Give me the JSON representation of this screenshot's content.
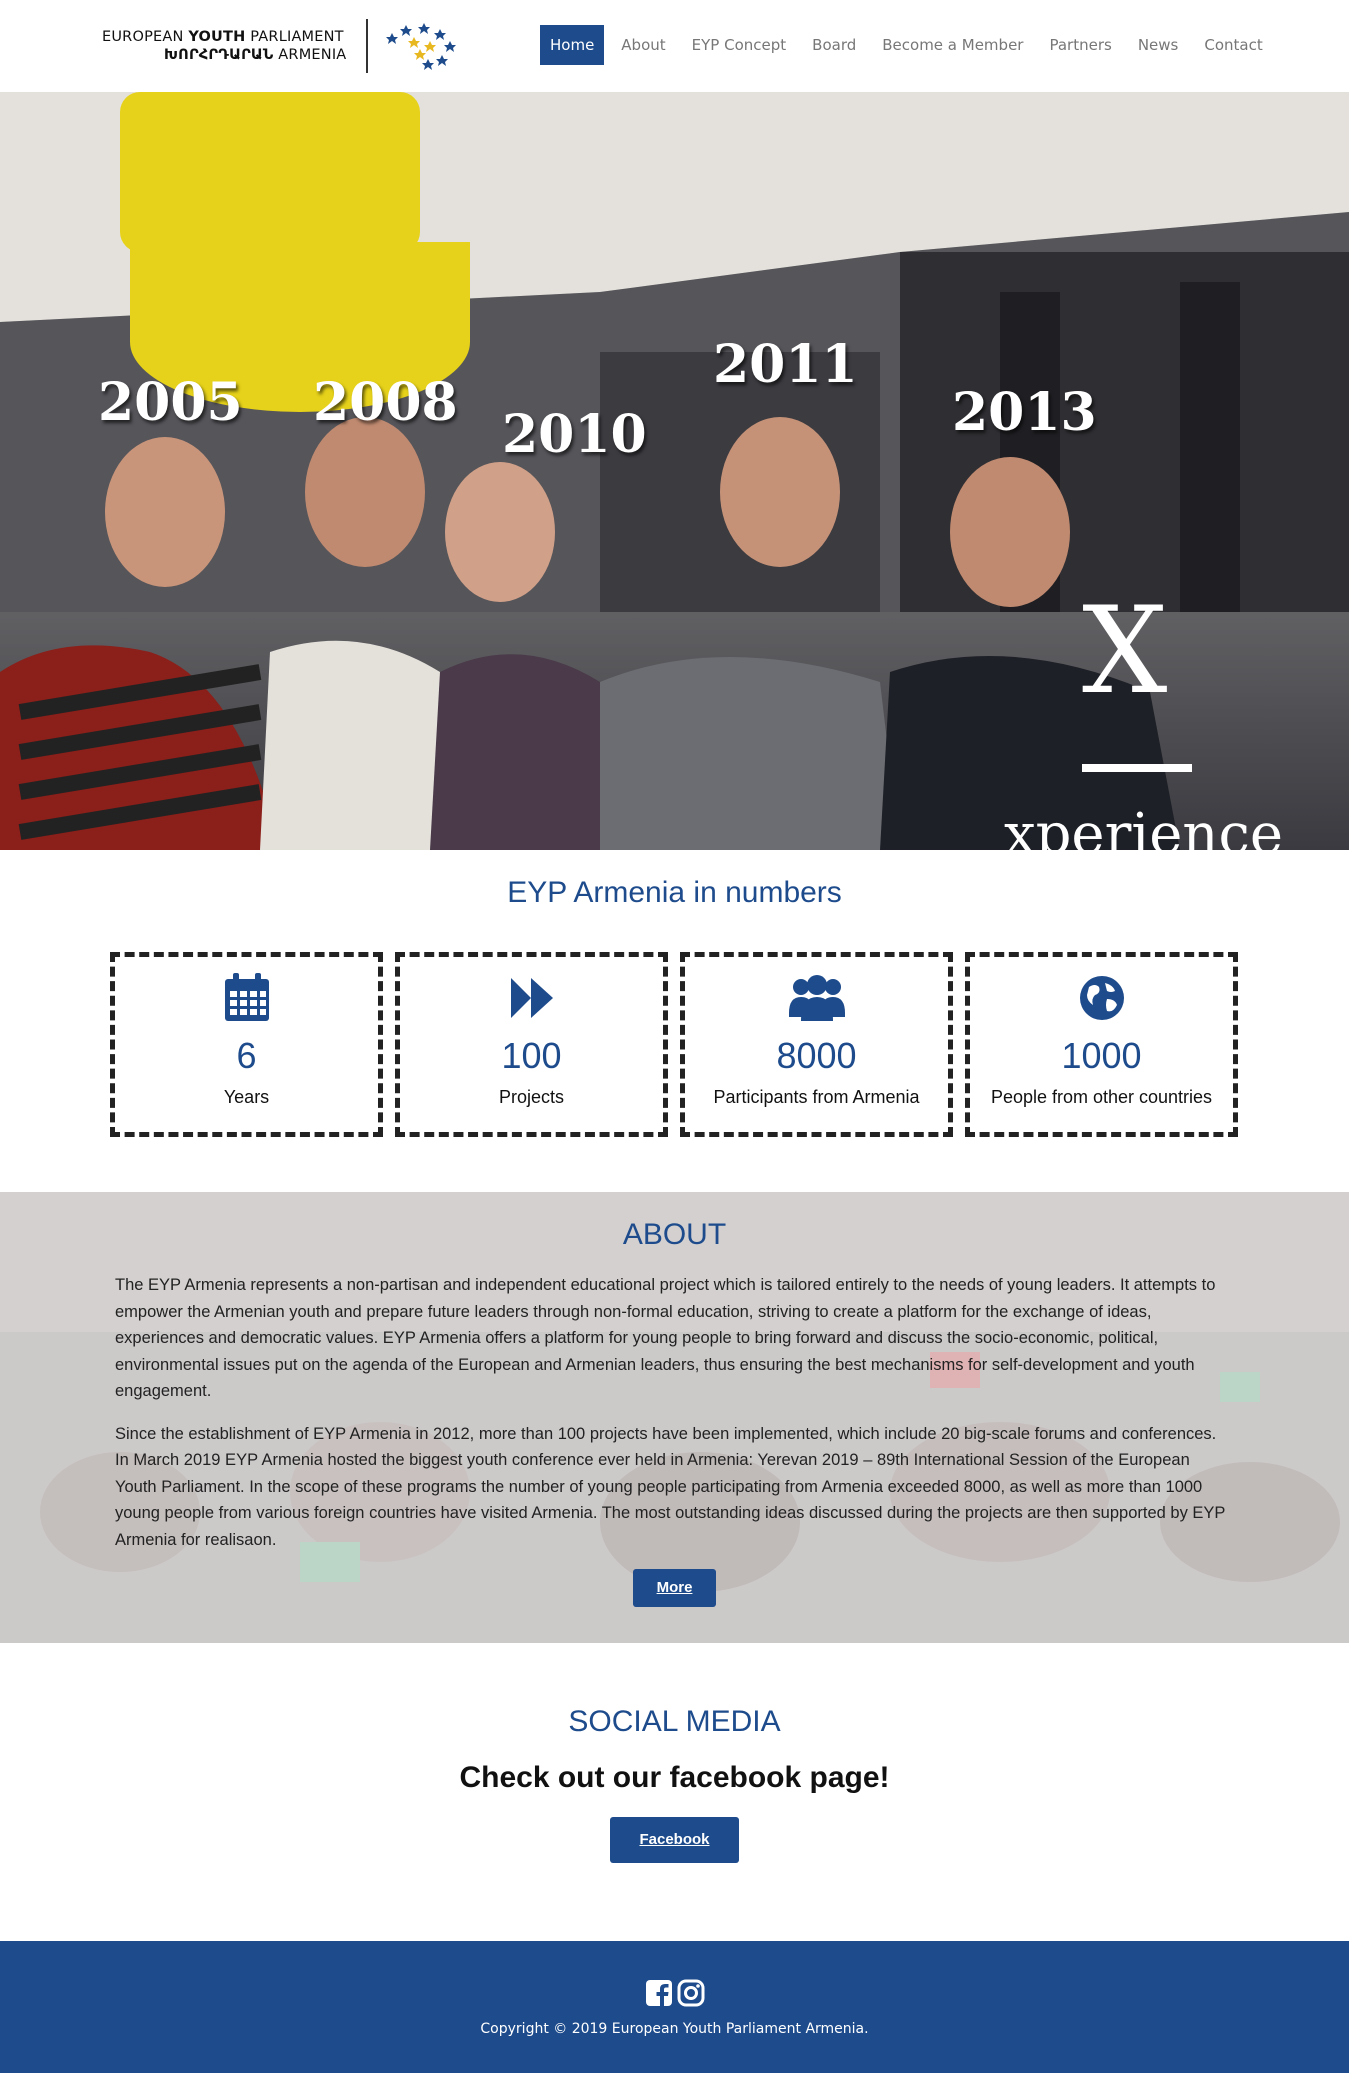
{
  "header": {
    "logo_line1_a": "EUROPEAN ",
    "logo_line1_b": "YOUTH",
    "logo_line1_c": " PARLIAMENT",
    "logo_line2_a": "ԽՈՐՀՐԴԱՐԱՆ",
    "logo_line2_b": " ARMENIA",
    "nav": [
      "Home",
      "About",
      "EYP Concept",
      "Board",
      "Become a Member",
      "Partners",
      "News",
      "Contact"
    ],
    "active_nav": "Home"
  },
  "hero": {
    "years": [
      "2005",
      "2008",
      "2010",
      "2011",
      "2013"
    ],
    "x_letter": "X",
    "tagline": "xperience"
  },
  "numbers": {
    "title": "EYP Armenia in numbers",
    "stats": [
      {
        "icon": "calendar-icon",
        "value": "6",
        "label": "Years"
      },
      {
        "icon": "fast-forward-icon",
        "value": "100",
        "label": "Projects"
      },
      {
        "icon": "users-icon",
        "value": "8000",
        "label": "Participants from Armenia"
      },
      {
        "icon": "globe-icon",
        "value": "1000",
        "label": "People from other countries"
      }
    ]
  },
  "about": {
    "title": "ABOUT",
    "p1": "The EYP Armenia represents a non-partisan and independent educational project which is tailored entirely to the needs of young leaders. It attempts to empower the Armenian youth and prepare future leaders through non-formal education, striving to create a platform for the exchange of ideas, experiences and democratic values. EYP Armenia offers a platform for young people to bring forward and discuss the socio-economic, political, environmental issues put on the agenda of the European and Armenian leaders, thus ensuring the best mechanisms for self-development and youth engagement.",
    "p2": "Since the establishment of EYP Armenia in 2012, more than 100 projects have been implemented, which include 20 big-scale forums and conferences. In March 2019 EYP Armenia hosted the biggest youth conference ever held in Armenia: Yerevan 2019 – 89th International Session of the European Youth Parliament. In the scope of these programs the number of young people participating from Armenia exceeded 8000, as well as more than 1000 young people from various foreign countries have visited Armenia. The most outstanding ideas discussed during the projects are then supported by EYP Armenia for realisaon.",
    "button": "More"
  },
  "social": {
    "title": "SOCIAL MEDIA",
    "heading": "Check out our facebook page!",
    "button": "Facebook"
  },
  "footer": {
    "icons": [
      "facebook-icon",
      "instagram-icon"
    ],
    "copyright": "Copyright © 2019 European Youth Parliament Armenia."
  },
  "colors": {
    "brand_blue": "#1d4b8c",
    "nav_text": "#777777",
    "footer_bg": "#1d4b8c"
  }
}
